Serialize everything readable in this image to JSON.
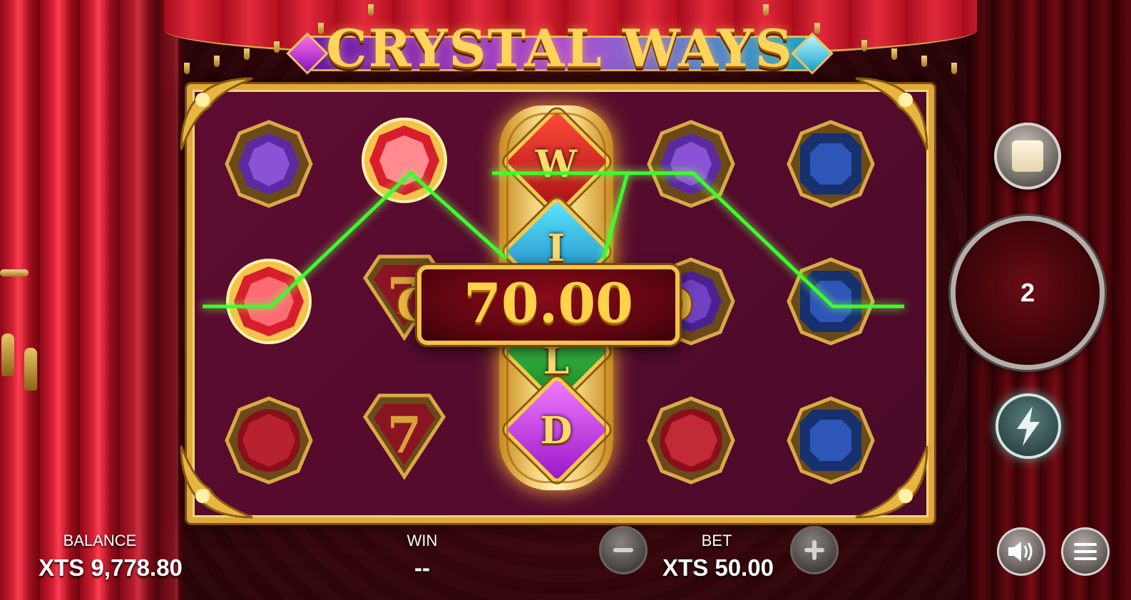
{
  "game": {
    "title": "CRYSTAL WAYS",
    "win_amount": "70.00",
    "wild_letters": [
      "W",
      "I",
      "L",
      "D"
    ]
  },
  "reels": [
    [
      "purple-gem",
      "red-gem",
      "red-gem"
    ],
    [
      "red-gem",
      "seven",
      "seven"
    ],
    [
      "wild",
      "wild",
      "wild"
    ],
    [
      "purple-gem",
      "purple-gem",
      "red-gem"
    ],
    [
      "blue-gem",
      "blue-gem",
      "blue-gem"
    ]
  ],
  "controls": {
    "spin_count": "2",
    "icons": [
      "stop-icon",
      "lightning-icon",
      "speaker-icon",
      "menu-icon",
      "minus-icon",
      "plus-icon"
    ]
  },
  "hud": {
    "balance_label": "BALANCE",
    "balance_value": "XTS 9,778.80",
    "win_label": "WIN",
    "win_value": "--",
    "bet_label": "BET",
    "bet_value": "XTS 50.00"
  },
  "colors": {
    "payline": "#39ff2a",
    "gold": "#f2c24c",
    "board": "#5a0c2e"
  }
}
